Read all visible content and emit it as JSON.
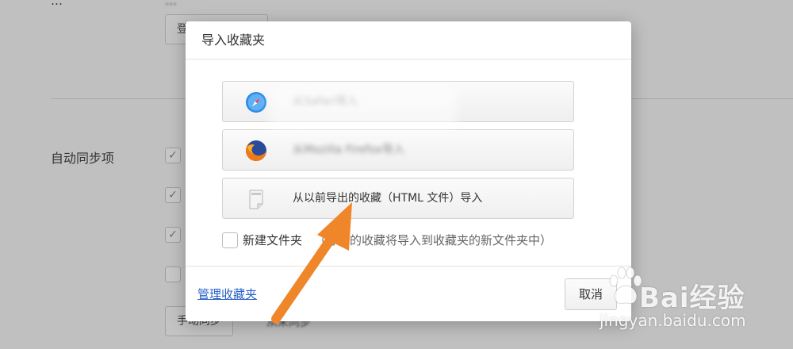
{
  "background": {
    "top_label": "…",
    "top_text": "…",
    "login_button": "登",
    "sync_label": "自动同步项",
    "checkboxes": [
      "✓",
      "✓",
      "✓",
      ""
    ],
    "manual_sync_button": "手动同步",
    "never_sync_text": "从未同步"
  },
  "dialog": {
    "title": "导入收藏夹",
    "options": [
      {
        "label": "从Safari导入",
        "icon": "safari-compass-icon"
      },
      {
        "label": "从Mozilla Firefox导入",
        "icon": "firefox-icon"
      },
      {
        "label": "从以前导出的收藏（HTML 文件）导入",
        "icon": "html-file-icon"
      }
    ],
    "new_folder_label": "新建文件夹",
    "new_folder_hint": "（导入的收藏将导入到收藏夹的新文件夹中）",
    "manage_link": "管理收藏夹",
    "cancel_button": "取消"
  },
  "watermark": {
    "logo_text": "Bai",
    "logo_text_suffix": "经验",
    "url": "jingyan.baidu.com"
  },
  "colors": {
    "link": "#2a62c9",
    "arrow": "#f0862a",
    "overlay": "rgba(0,0,0,0.22)"
  }
}
